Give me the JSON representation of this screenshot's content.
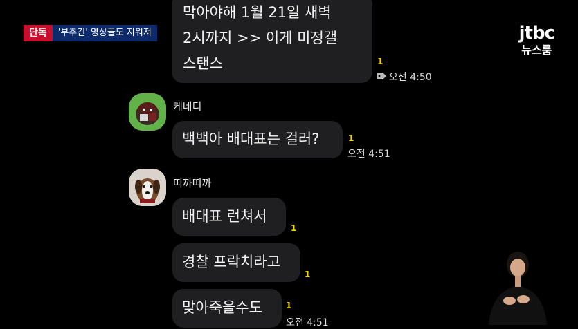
{
  "news": {
    "exclusive_label": "단독",
    "headline": "'부추긴' 영상들도 지워져",
    "logo_top": "jtbc",
    "logo_bottom": "뉴스룸"
  },
  "chat": {
    "messages": [
      {
        "sender": "",
        "lines": [
          "막아야해 1월 21일 새벽",
          "2시까지 >> 이게 미정갤",
          "스탠스"
        ],
        "unread": "1",
        "time": "오전 4:50",
        "icon": "tag-icon"
      },
      {
        "sender": "케네디",
        "lines": [
          "백백아 배대표는 걸러?"
        ],
        "unread": "1",
        "time": "오전 4:51"
      },
      {
        "sender": "띠까띠까",
        "lines": [
          "배대표 런쳐서"
        ],
        "unread": "1"
      },
      {
        "sender": "",
        "lines": [
          "경찰 프락치라고"
        ],
        "unread": "1"
      },
      {
        "sender": "",
        "lines": [
          "맞아죽을수도"
        ],
        "unread": "1",
        "time": "오전 4:51"
      }
    ]
  }
}
